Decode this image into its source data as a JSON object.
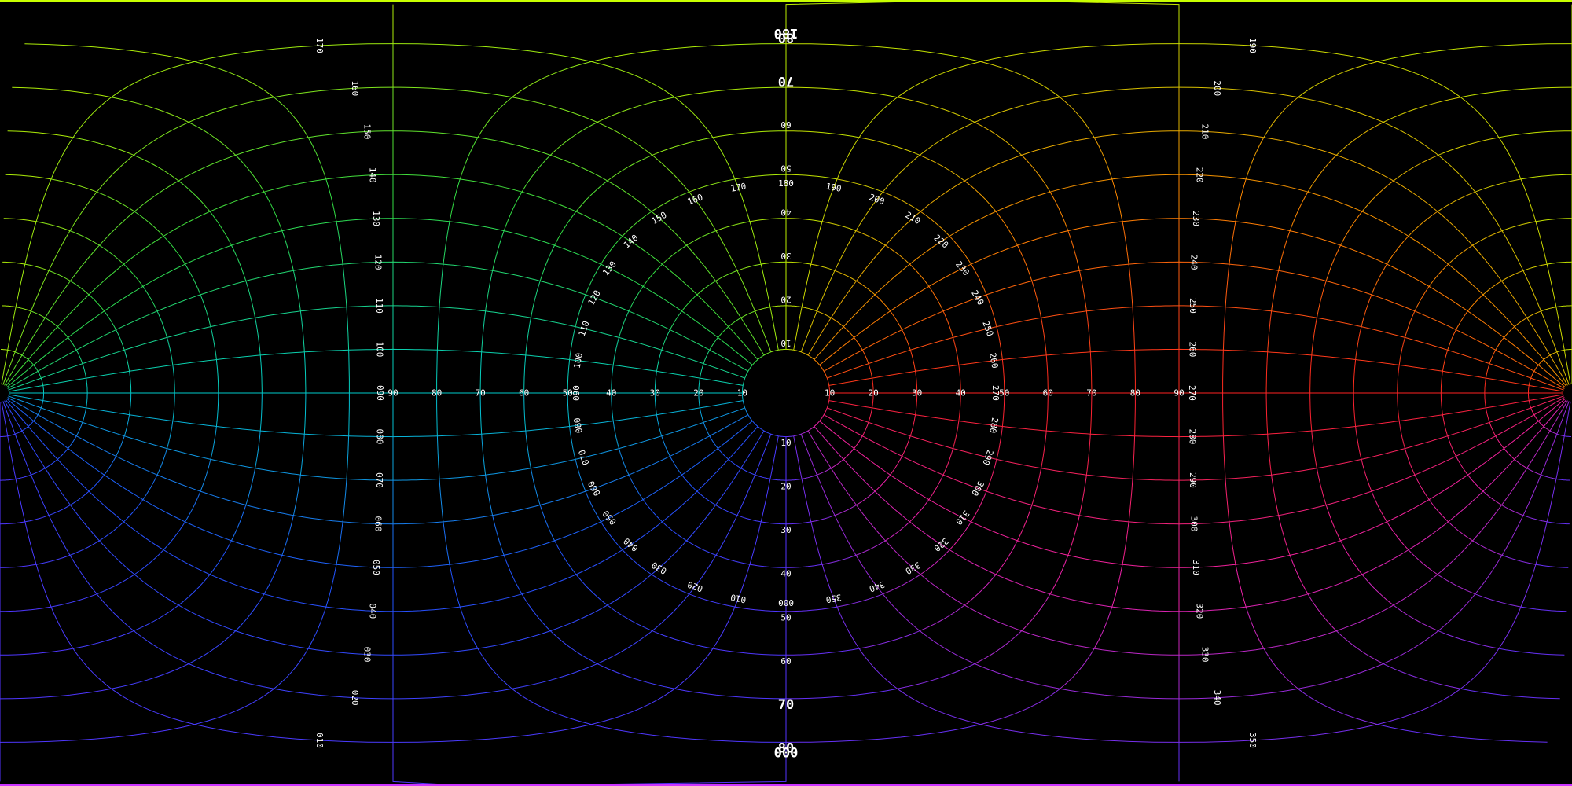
{
  "diagram": {
    "type": "equirectangular-polar-grid",
    "background_color": "#000000",
    "line_colors": {
      "top_pole": "#c8ff00",
      "bottom_pole": "#cc33ff",
      "east": "#ff2222",
      "north": "#bbee00",
      "west": "#00cccc",
      "south": "#5533ff"
    },
    "elevation_rings": [
      10,
      20,
      30,
      40,
      50,
      60,
      70,
      80
    ],
    "azimuth_step": 10,
    "labels": {
      "horizontal_left_elev": [
        "90",
        "80",
        "70",
        "60",
        "50",
        "40",
        "30",
        "20",
        "10"
      ],
      "horizontal_right_elev": [
        "10",
        "20",
        "30",
        "40",
        "50",
        "60",
        "70",
        "80",
        "90"
      ],
      "vertical_up_elev": [
        "10",
        "20",
        "30",
        "40",
        "50",
        "60",
        "70",
        "80"
      ],
      "vertical_down_elev": [
        "10",
        "20",
        "30",
        "40",
        "50",
        "60",
        "70",
        "80"
      ],
      "inner_ring_azimuths": [
        "170",
        "160",
        "150",
        "140",
        "130",
        "120",
        "110",
        "100",
        "090",
        "080",
        "070",
        "060",
        "050",
        "040",
        "030",
        "020",
        "010",
        "000",
        "350",
        "340",
        "330",
        "320",
        "310",
        "300",
        "290",
        "280",
        "270",
        "260",
        "250",
        "240",
        "230",
        "220",
        "210",
        "200",
        "190",
        "180"
      ],
      "right_column_azimuths": [
        "100",
        "110",
        "120",
        "130",
        "140",
        "150",
        "160",
        "170",
        "090",
        "080",
        "070",
        "060",
        "050",
        "040",
        "030",
        "020",
        "010"
      ],
      "left_column_azimuths": [
        "260",
        "250",
        "240",
        "230",
        "220",
        "210",
        "200",
        "190",
        "270",
        "280",
        "290",
        "300",
        "310",
        "320",
        "330",
        "340",
        "350"
      ],
      "top_pole_label": "180",
      "bottom_pole_label": "000"
    }
  }
}
